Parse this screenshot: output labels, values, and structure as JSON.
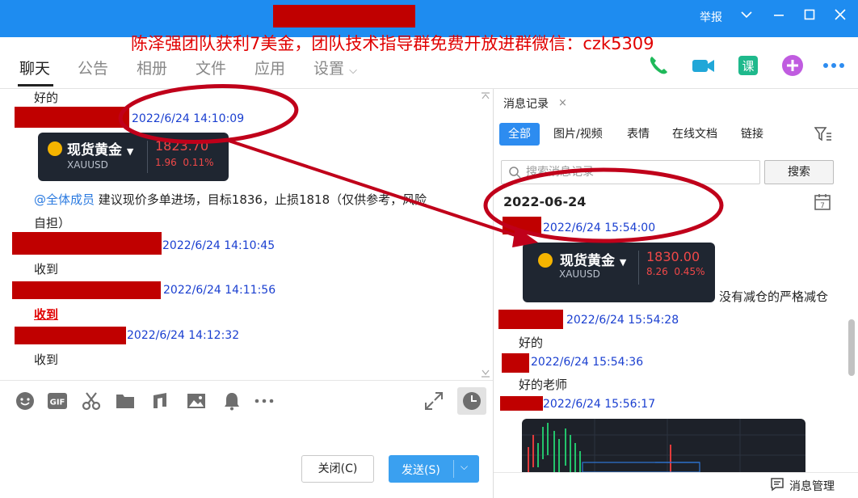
{
  "titlebar": {
    "report": "举报",
    "colors": {
      "bar": "#1e8cf0",
      "redaction": "#c00000"
    }
  },
  "overlay_text": "陈泽强团队获利7美金，团队技术指导群免费开放进群微信：czk5309",
  "nav": {
    "tabs": [
      "聊天",
      "公告",
      "相册",
      "文件",
      "应用",
      "设置"
    ],
    "settings_chevron": "⌵",
    "icons": [
      "phone-icon",
      "video-call-icon",
      "lesson-icon",
      "add-icon",
      "more-icon"
    ]
  },
  "chat": {
    "messages": [
      {
        "text": "好的"
      },
      {
        "timestamp": "2022/6/24 14:10:09"
      },
      {
        "card": {
          "name": "现货黄金",
          "symbol": "XAUUSD",
          "price": "1823.70",
          "change": "1.96",
          "pct": "0.11%"
        }
      },
      {
        "mention": "@全体成员",
        "text": " 建议现价多单进场，目标1836，止损1818（仅供参考，风险",
        "text2": "自担）"
      },
      {
        "timestamp": "2022/6/24 14:10:45"
      },
      {
        "text": "收到"
      },
      {
        "timestamp": "2022/6/24 14:11:56"
      },
      {
        "text": "收到"
      },
      {
        "timestamp": "2022/6/24 14:12:32"
      },
      {
        "text": "收到"
      }
    ]
  },
  "composer": {
    "tools": [
      "emoji-icon",
      "gif-icon",
      "scissors-icon",
      "folder-icon",
      "music-icon",
      "image-icon",
      "bell-icon",
      "more-dots-icon"
    ],
    "close_label": "关闭(C)",
    "send_label": "发送(S)",
    "send_arrow": "⌵"
  },
  "right_panel": {
    "tab_title": "消息记录",
    "tab_close": "×",
    "filters": [
      "全部",
      "图片/视频",
      "表情",
      "在线文档",
      "链接"
    ],
    "search_placeholder": "搜索消息记录",
    "search_button": "搜索",
    "date_heading": "2022-06-24",
    "entries": [
      {
        "timestamp": "2022/6/24 15:54:00"
      },
      {
        "card": {
          "name": "现货黄金",
          "symbol": "XAUUSD",
          "price": "1830.00",
          "change": "8.26",
          "pct": "0.45%"
        },
        "text": "没有减仓的严格减仓"
      },
      {
        "timestamp": "2022/6/24 15:54:28"
      },
      {
        "text": "好的"
      },
      {
        "timestamp": "2022/6/24 15:54:36"
      },
      {
        "text": "好的老师"
      },
      {
        "timestamp": "2022/6/24 15:56:17"
      }
    ],
    "manage_label": "消息管理"
  }
}
